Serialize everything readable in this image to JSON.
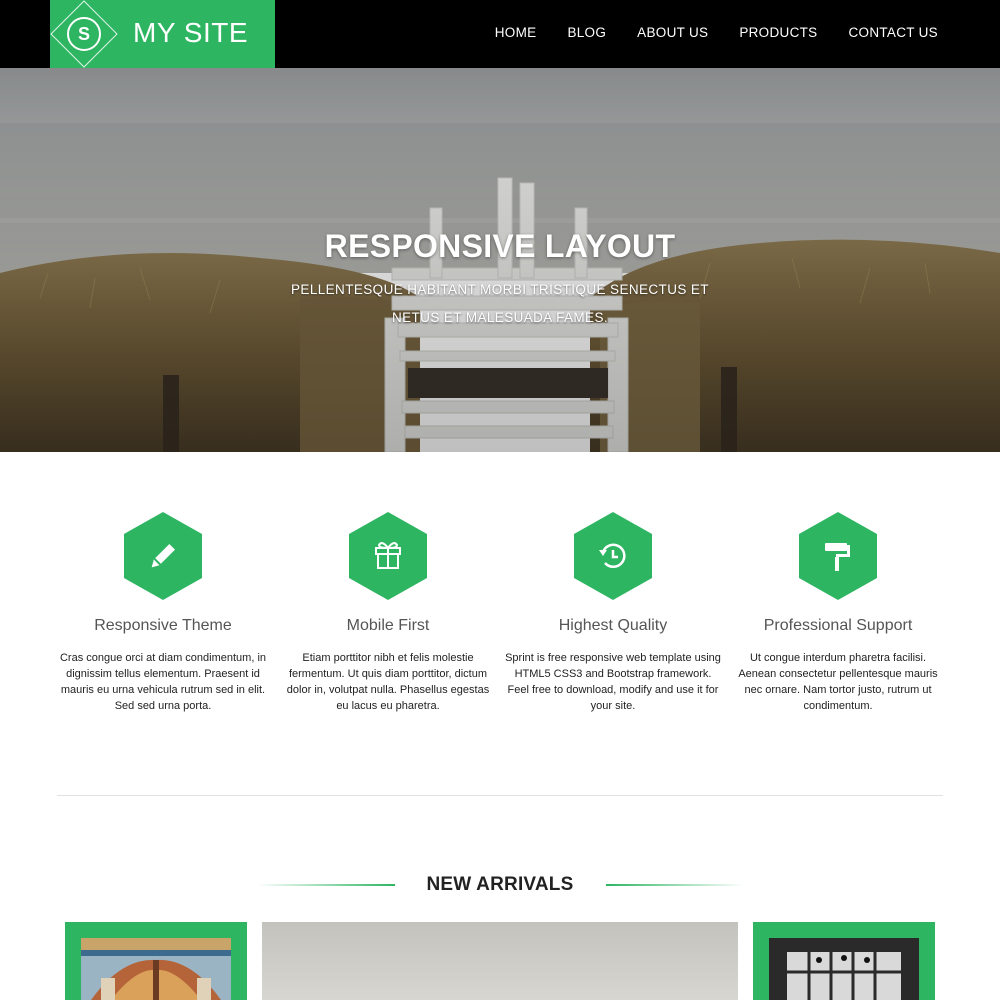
{
  "brand": {
    "letter": "S",
    "name": "MY SITE"
  },
  "nav": {
    "items": [
      "HOME",
      "BLOG",
      "ABOUT US",
      "PRODUCTS",
      "CONTACT US"
    ]
  },
  "hero": {
    "title": "RESPONSIVE LAYOUT",
    "subtitle": "PELLENTESQUE HABITANT MORBI TRISTIQUE SENECTUS ET NETUS ET MALESUADA FAMES."
  },
  "features": [
    {
      "icon": "pencil-icon",
      "title": "Responsive Theme",
      "text": "Cras congue orci at diam condimentum, in dignissim tellus elementum. Praesent id mauris eu urna vehicula rutrum sed in elit. Sed sed urna porta."
    },
    {
      "icon": "gift-icon",
      "title": "Mobile First",
      "text": "Etiam porttitor nibh et felis molestie fermentum. Ut quis diam porttitor, dictum dolor in, volutpat nulla. Phasellus egestas eu lacus eu pharetra."
    },
    {
      "icon": "history-icon",
      "title": "Highest Quality",
      "text": "Sprint is free responsive web template using HTML5 CSS3 and Bootstrap framework. Feel free to download, modify and use it for your site."
    },
    {
      "icon": "paint-roller-icon",
      "title": "Professional Support",
      "text": "Ut congue interdum pharetra facilisi. Aenean consectetur pellentesque mauris nec ornare. Nam tortor justo, rutrum ut condimentum."
    }
  ],
  "arrivals": {
    "title": "NEW ARRIVALS"
  },
  "colors": {
    "accent": "#2db562",
    "navbar": "#000000"
  }
}
